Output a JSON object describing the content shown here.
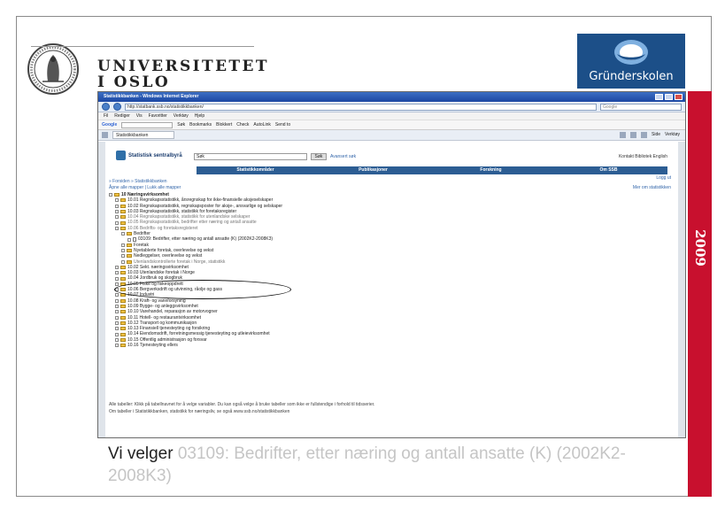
{
  "slide": {
    "university_line1": "UNIVERSITETET",
    "university_line2": "I OSLO",
    "partner_logo_text": "Gründerskolen",
    "year": "2009",
    "caption_prefix": "Vi velger ",
    "caption_link": "03109: Bedrifter, etter næring og antall ansatte (K) (2002K2-2008K3)"
  },
  "browser": {
    "window_title": "Statistikkbanken - Windows Internet Explorer",
    "address": "http://statbank.ssb.no/statistikkbanken/",
    "search_placeholder": "Google",
    "menu": [
      "Fil",
      "Rediger",
      "Vis",
      "Favoritter",
      "Verktøy",
      "Hjelp"
    ],
    "google_label": "Google",
    "google_items": [
      "Søk",
      "Bookmarks",
      "Blokkert",
      "Check",
      "AutoLink",
      "Send to"
    ],
    "tab_label": "Statistikkbanken",
    "tools": [
      "Side",
      "Verktøy"
    ]
  },
  "ssb": {
    "name": "Statistisk sentralbyrå",
    "search_value": "Søk",
    "search_button": "Søk",
    "advanced": "Avansert søk",
    "top_links": "Kontakt   Bibliotek   English",
    "nav": [
      "Statistikkområder",
      "Publikasjoner",
      "Forskning",
      "Om SSB"
    ],
    "breadcrumbs": "» Forsiden » Statistikkbanken",
    "expand": "Åpne alle mapper | Lukk alle mapper",
    "logout": "Logg ut",
    "right_link": "Mer om statistikken"
  },
  "tree": [
    {
      "text": "10 Næringsvirksomhet",
      "indent": 0,
      "type": "folder",
      "bold": true
    },
    {
      "text": "10.01 Regnskapsstatistikk, årsregnskap for ikke-finansielle aksjeselskaper",
      "indent": 1,
      "type": "folder"
    },
    {
      "text": "10.02 Regnskapsstatistikk, regnskapsposter for aksje-, ansvarlige og selskaper",
      "indent": 1,
      "type": "folder"
    },
    {
      "text": "10.03 Regnskapsstatistikk, statistikk for foretaksregister",
      "indent": 1,
      "type": "folder"
    },
    {
      "text": "10.04 Regnskapsstatistikk, statistikk for utenlandske selskaper",
      "indent": 1,
      "type": "folder",
      "gray": true
    },
    {
      "text": "10.05 Regnskapsstatistikk, bedrifter etter næring og antall ansatte",
      "indent": 1,
      "type": "folder",
      "gray": true
    },
    {
      "text": "10.06 Bedrifts- og foretaksregisteret",
      "indent": 1,
      "type": "folder",
      "gray": true
    },
    {
      "text": "Bedrifter",
      "indent": 2,
      "type": "folder"
    },
    {
      "text": "03109: Bedrifter, etter næring og antall ansatte (K) (2002K2-2008K3)",
      "indent": 3,
      "type": "doc"
    },
    {
      "text": "Foretak",
      "indent": 2,
      "type": "folder"
    },
    {
      "text": "Nyetablerte foretak, overlevelse og vekst",
      "indent": 2,
      "type": "folder"
    },
    {
      "text": "Nedleggelser, overlevelse og vekst",
      "indent": 2,
      "type": "folder"
    },
    {
      "text": "Utenlandskontrollerte foretak i Norge, statistikk",
      "indent": 2,
      "type": "folder",
      "gray": true
    },
    {
      "text": "10.02 Sekt. næringsvirksomhet",
      "indent": 1,
      "type": "folder"
    },
    {
      "text": "10.03 Utenlandske foretak i Norge",
      "indent": 1,
      "type": "folder"
    },
    {
      "text": "10.04 Jordbruk og skogbruk",
      "indent": 1,
      "type": "folder"
    },
    {
      "text": "10.05 Fiske og fiskeoppdrett",
      "indent": 1,
      "type": "folder"
    },
    {
      "text": "10.06 Bergverksdrift og utvinning, råolje og gass",
      "indent": 1,
      "type": "folder"
    },
    {
      "text": "10.07 Industri",
      "indent": 1,
      "type": "folder"
    },
    {
      "text": "10.08 Kraft- og vannforsyning",
      "indent": 1,
      "type": "folder"
    },
    {
      "text": "10.09 Bygge- og anleggsvirksomhet",
      "indent": 1,
      "type": "folder"
    },
    {
      "text": "10.10 Varehandel, reparasjon av motorvogner",
      "indent": 1,
      "type": "folder"
    },
    {
      "text": "10.11 Hotell- og restaurantvirksomhet",
      "indent": 1,
      "type": "folder"
    },
    {
      "text": "10.12 Transport og kommunikasjon",
      "indent": 1,
      "type": "folder"
    },
    {
      "text": "10.13 Finansiell tjenesteyting og forsikring",
      "indent": 1,
      "type": "folder"
    },
    {
      "text": "10.14 Eiendomsdrift, forretningsmessig tjenesteyting og utleievirksomhet",
      "indent": 1,
      "type": "folder"
    },
    {
      "text": "10.15 Offentlig administrasjon og forsvar",
      "indent": 1,
      "type": "folder"
    },
    {
      "text": "10.16 Tjenesteyting ellers",
      "indent": 1,
      "type": "folder"
    }
  ],
  "footnote_1": "Alle tabeller: Klikk på tabellnavnet for å velge variabler. Du kan også velge å bruke tabeller som ikke er fullstendige i forhold til tidsserier.",
  "footnote_2": "Om tabeller i Statistikkbanken, statistikk for næringsliv, se også www.ssb.no/statistikkbanken"
}
